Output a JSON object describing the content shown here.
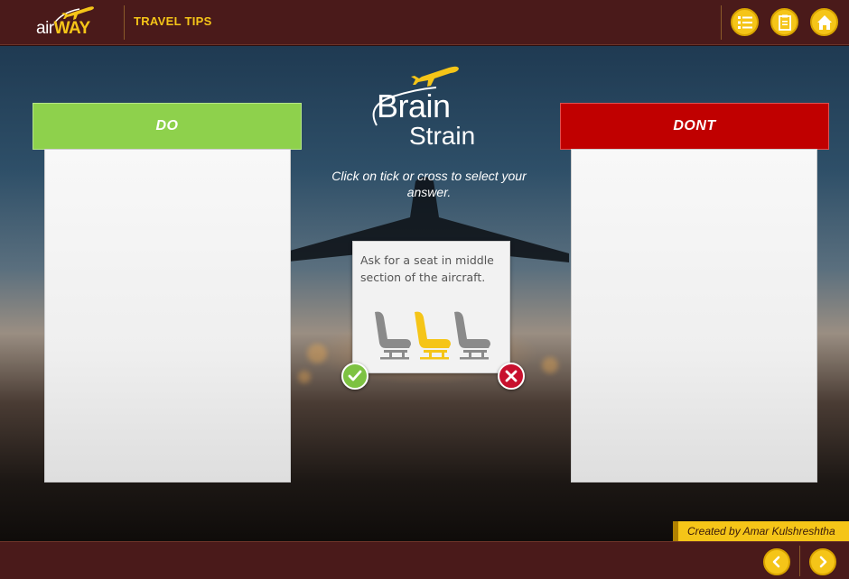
{
  "header": {
    "logo": {
      "air": "air",
      "way": "WAY"
    },
    "section_title": "TRAVEL TIPS",
    "buttons": [
      {
        "icon": "list-icon"
      },
      {
        "icon": "notes-icon"
      },
      {
        "icon": "home-icon"
      }
    ]
  },
  "activity": {
    "do_label": "DO",
    "dont_label": "DONT",
    "title_line1": "Brain",
    "title_line2": "Strain",
    "instruction": "Click on tick or cross to select your answer.",
    "card_text": "Ask for a seat in middle section of the aircraft.",
    "tick_icon": "tick-icon",
    "cross_icon": "cross-icon"
  },
  "credit": "Created by Amar Kulshreshtha",
  "footer": {
    "prev_icon": "chevron-left-icon",
    "next_icon": "chevron-right-icon"
  },
  "colors": {
    "brand_dark": "#4a1a1a",
    "accent_yellow": "#f5c518",
    "do_green": "#8ed14c",
    "dont_red": "#c00000"
  }
}
